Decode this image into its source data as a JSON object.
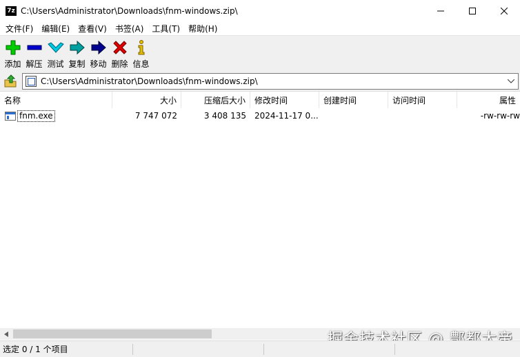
{
  "window": {
    "app_icon_text": "7z",
    "title": "C:\\Users\\Administrator\\Downloads\\fnm-windows.zip\\"
  },
  "menu": [
    {
      "label": "文件(F)"
    },
    {
      "label": "编辑(E)"
    },
    {
      "label": "查看(V)"
    },
    {
      "label": "书签(A)"
    },
    {
      "label": "工具(T)"
    },
    {
      "label": "帮助(H)"
    }
  ],
  "toolbar": {
    "buttons": [
      {
        "label": "添加",
        "icon": "plus-icon",
        "color": "#00cc00"
      },
      {
        "label": "解压",
        "icon": "minus-icon",
        "color": "#0000cc"
      },
      {
        "label": "测试",
        "icon": "check-icon",
        "color": "#00a0c0"
      },
      {
        "label": "复制",
        "icon": "copy-arrow-icon",
        "color": "#008080"
      },
      {
        "label": "移动",
        "icon": "move-arrow-icon",
        "color": "#000080"
      },
      {
        "label": "删除",
        "icon": "delete-x-icon",
        "color": "#e00000"
      },
      {
        "label": "信息",
        "icon": "info-icon",
        "color": "#d4b000"
      }
    ]
  },
  "address": {
    "path": "C:\\Users\\Administrator\\Downloads\\fnm-windows.zip\\"
  },
  "list": {
    "columns": {
      "name": "名称",
      "size": "大小",
      "packed": "压缩后大小",
      "modified": "修改时间",
      "created": "创建时间",
      "accessed": "访问时间",
      "attributes": "属性"
    },
    "rows": [
      {
        "name": "fnm.exe",
        "size": "7 747 072",
        "packed": "3 408 135",
        "modified": "2024-11-17 0...",
        "created": "",
        "accessed": "",
        "attributes": "-rw-rw-rw"
      }
    ]
  },
  "status": {
    "text": "选定 0 / 1 个项目"
  },
  "watermark": "掘金技术社区 @ 鄷都大帝"
}
